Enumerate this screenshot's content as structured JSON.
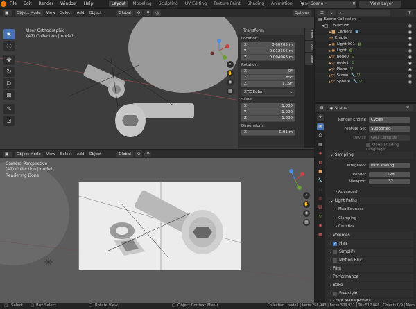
{
  "menu": [
    "File",
    "Edit",
    "Render",
    "Window",
    "Help"
  ],
  "workspace_tabs": [
    "Layout",
    "Modeling",
    "Sculpting",
    "UV Editing",
    "Texture Paint",
    "Shading",
    "Animation",
    "Renderi"
  ],
  "scene_name": "Scene",
  "view_layer": "View Layer",
  "vp1": {
    "mode": "Object Mode",
    "menus": [
      "View",
      "Select",
      "Add",
      "Object"
    ],
    "orientation": "Global",
    "options": "Options",
    "view_name": "User Orthographic",
    "collection_info": "(47) Collection | node1"
  },
  "vp2": {
    "mode": "Object Mode",
    "menus": [
      "View",
      "Select",
      "Add",
      "Object"
    ],
    "orientation": "Global",
    "view_name": "Camera Perspective",
    "collection_info": "(47) Collection | node1",
    "render_status": "Rendering Done"
  },
  "npanel": {
    "title": "Transform",
    "location_label": "Location:",
    "location": [
      {
        "axis": "X",
        "value": "0.00705 m"
      },
      {
        "axis": "Y",
        "value": "0.012556 m"
      },
      {
        "axis": "Z",
        "value": "0.004963 m"
      }
    ],
    "rotation_label": "Rotation:",
    "rotation": [
      {
        "axis": "X",
        "value": "0°"
      },
      {
        "axis": "Y",
        "value": "85°"
      },
      {
        "axis": "Z",
        "value": "11.9°"
      }
    ],
    "rotation_mode": "XYZ Euler",
    "scale_label": "Scale:",
    "scale": [
      {
        "axis": "X",
        "value": "1.000"
      },
      {
        "axis": "Y",
        "value": "1.000"
      },
      {
        "axis": "Z",
        "value": "1.000"
      }
    ],
    "dimensions_label": "Dimensions:",
    "dimensions_x": {
      "axis": "X",
      "value": "0.01 m"
    },
    "tabs": [
      "Item",
      "Tool",
      "View"
    ]
  },
  "outliner": {
    "root": "Scene Collection",
    "collection": "Collection",
    "items": [
      {
        "name": "Camera",
        "icon": "camera-icon",
        "color": "#e0a060"
      },
      {
        "name": "Empty",
        "icon": "empty-icon",
        "color": "#e0a060"
      },
      {
        "name": "Light.001",
        "icon": "light-icon",
        "color": "#e0a060"
      },
      {
        "name": "Light",
        "icon": "light-icon",
        "color": "#e0a060"
      },
      {
        "name": "node0",
        "icon": "mesh-icon",
        "color": "#e0a060"
      },
      {
        "name": "node1",
        "icon": "mesh-icon",
        "color": "#e0a060"
      },
      {
        "name": "Plane",
        "icon": "mesh-icon",
        "color": "#e0a060"
      },
      {
        "name": "Screw",
        "icon": "mesh-icon",
        "color": "#e0a060"
      },
      {
        "name": "Sphere",
        "icon": "mesh-icon",
        "color": "#e0a060"
      }
    ]
  },
  "properties": {
    "scene_label": "Scene",
    "render_engine_label": "Render Engine",
    "render_engine": "Cycles",
    "feature_set_label": "Feature Set",
    "feature_set": "Supported",
    "device_label": "Device",
    "device": "GPU Compute",
    "osl_label": "Open Shading Language",
    "sampling_title": "Sampling",
    "integrator_label": "Integrator",
    "integrator": "Path Tracing",
    "render_label": "Render",
    "render_samples": "128",
    "viewport_label": "Viewport",
    "viewport_samples": "32",
    "sections": [
      "Advanced",
      "Light Paths",
      "Max Bounces",
      "Clamping",
      "Caustics",
      "Volumes",
      "Hair",
      "Simplify",
      "Motion Blur",
      "Film",
      "Performance",
      "Bake",
      "Freestyle",
      "Color Management"
    ]
  },
  "statusbar": {
    "select": "Select",
    "box_select": "Box Select",
    "rotate_view": "Rotate View",
    "context_menu": "Object Context Menu",
    "stats": "Collection | node1 | Verts:258,943 | Faces:509,931 | Tris:517,868 | Objects:0/9 | Mem"
  }
}
